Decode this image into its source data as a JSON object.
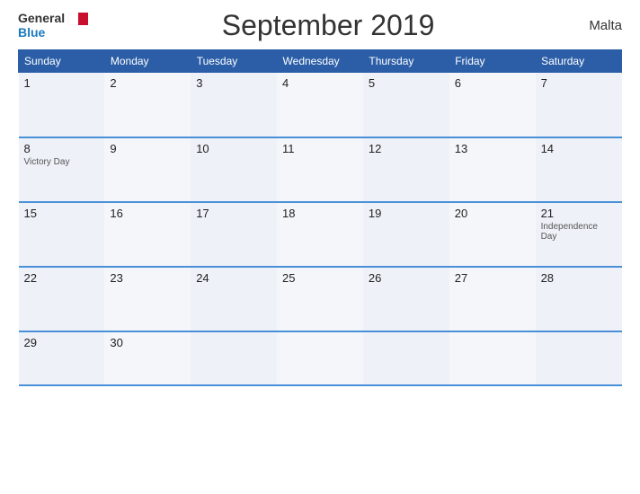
{
  "header": {
    "logo_general": "General",
    "logo_blue": "Blue",
    "title": "September 2019",
    "country": "Malta"
  },
  "days_of_week": [
    "Sunday",
    "Monday",
    "Tuesday",
    "Wednesday",
    "Thursday",
    "Friday",
    "Saturday"
  ],
  "weeks": [
    [
      {
        "day": "1",
        "holiday": ""
      },
      {
        "day": "2",
        "holiday": ""
      },
      {
        "day": "3",
        "holiday": ""
      },
      {
        "day": "4",
        "holiday": ""
      },
      {
        "day": "5",
        "holiday": ""
      },
      {
        "day": "6",
        "holiday": ""
      },
      {
        "day": "7",
        "holiday": ""
      }
    ],
    [
      {
        "day": "8",
        "holiday": "Victory Day"
      },
      {
        "day": "9",
        "holiday": ""
      },
      {
        "day": "10",
        "holiday": ""
      },
      {
        "day": "11",
        "holiday": ""
      },
      {
        "day": "12",
        "holiday": ""
      },
      {
        "day": "13",
        "holiday": ""
      },
      {
        "day": "14",
        "holiday": ""
      }
    ],
    [
      {
        "day": "15",
        "holiday": ""
      },
      {
        "day": "16",
        "holiday": ""
      },
      {
        "day": "17",
        "holiday": ""
      },
      {
        "day": "18",
        "holiday": ""
      },
      {
        "day": "19",
        "holiday": ""
      },
      {
        "day": "20",
        "holiday": ""
      },
      {
        "day": "21",
        "holiday": "Independence Day"
      }
    ],
    [
      {
        "day": "22",
        "holiday": ""
      },
      {
        "day": "23",
        "holiday": ""
      },
      {
        "day": "24",
        "holiday": ""
      },
      {
        "day": "25",
        "holiday": ""
      },
      {
        "day": "26",
        "holiday": ""
      },
      {
        "day": "27",
        "holiday": ""
      },
      {
        "day": "28",
        "holiday": ""
      }
    ],
    [
      {
        "day": "29",
        "holiday": ""
      },
      {
        "day": "30",
        "holiday": ""
      },
      {
        "day": "",
        "holiday": ""
      },
      {
        "day": "",
        "holiday": ""
      },
      {
        "day": "",
        "holiday": ""
      },
      {
        "day": "",
        "holiday": ""
      },
      {
        "day": "",
        "holiday": ""
      }
    ]
  ]
}
